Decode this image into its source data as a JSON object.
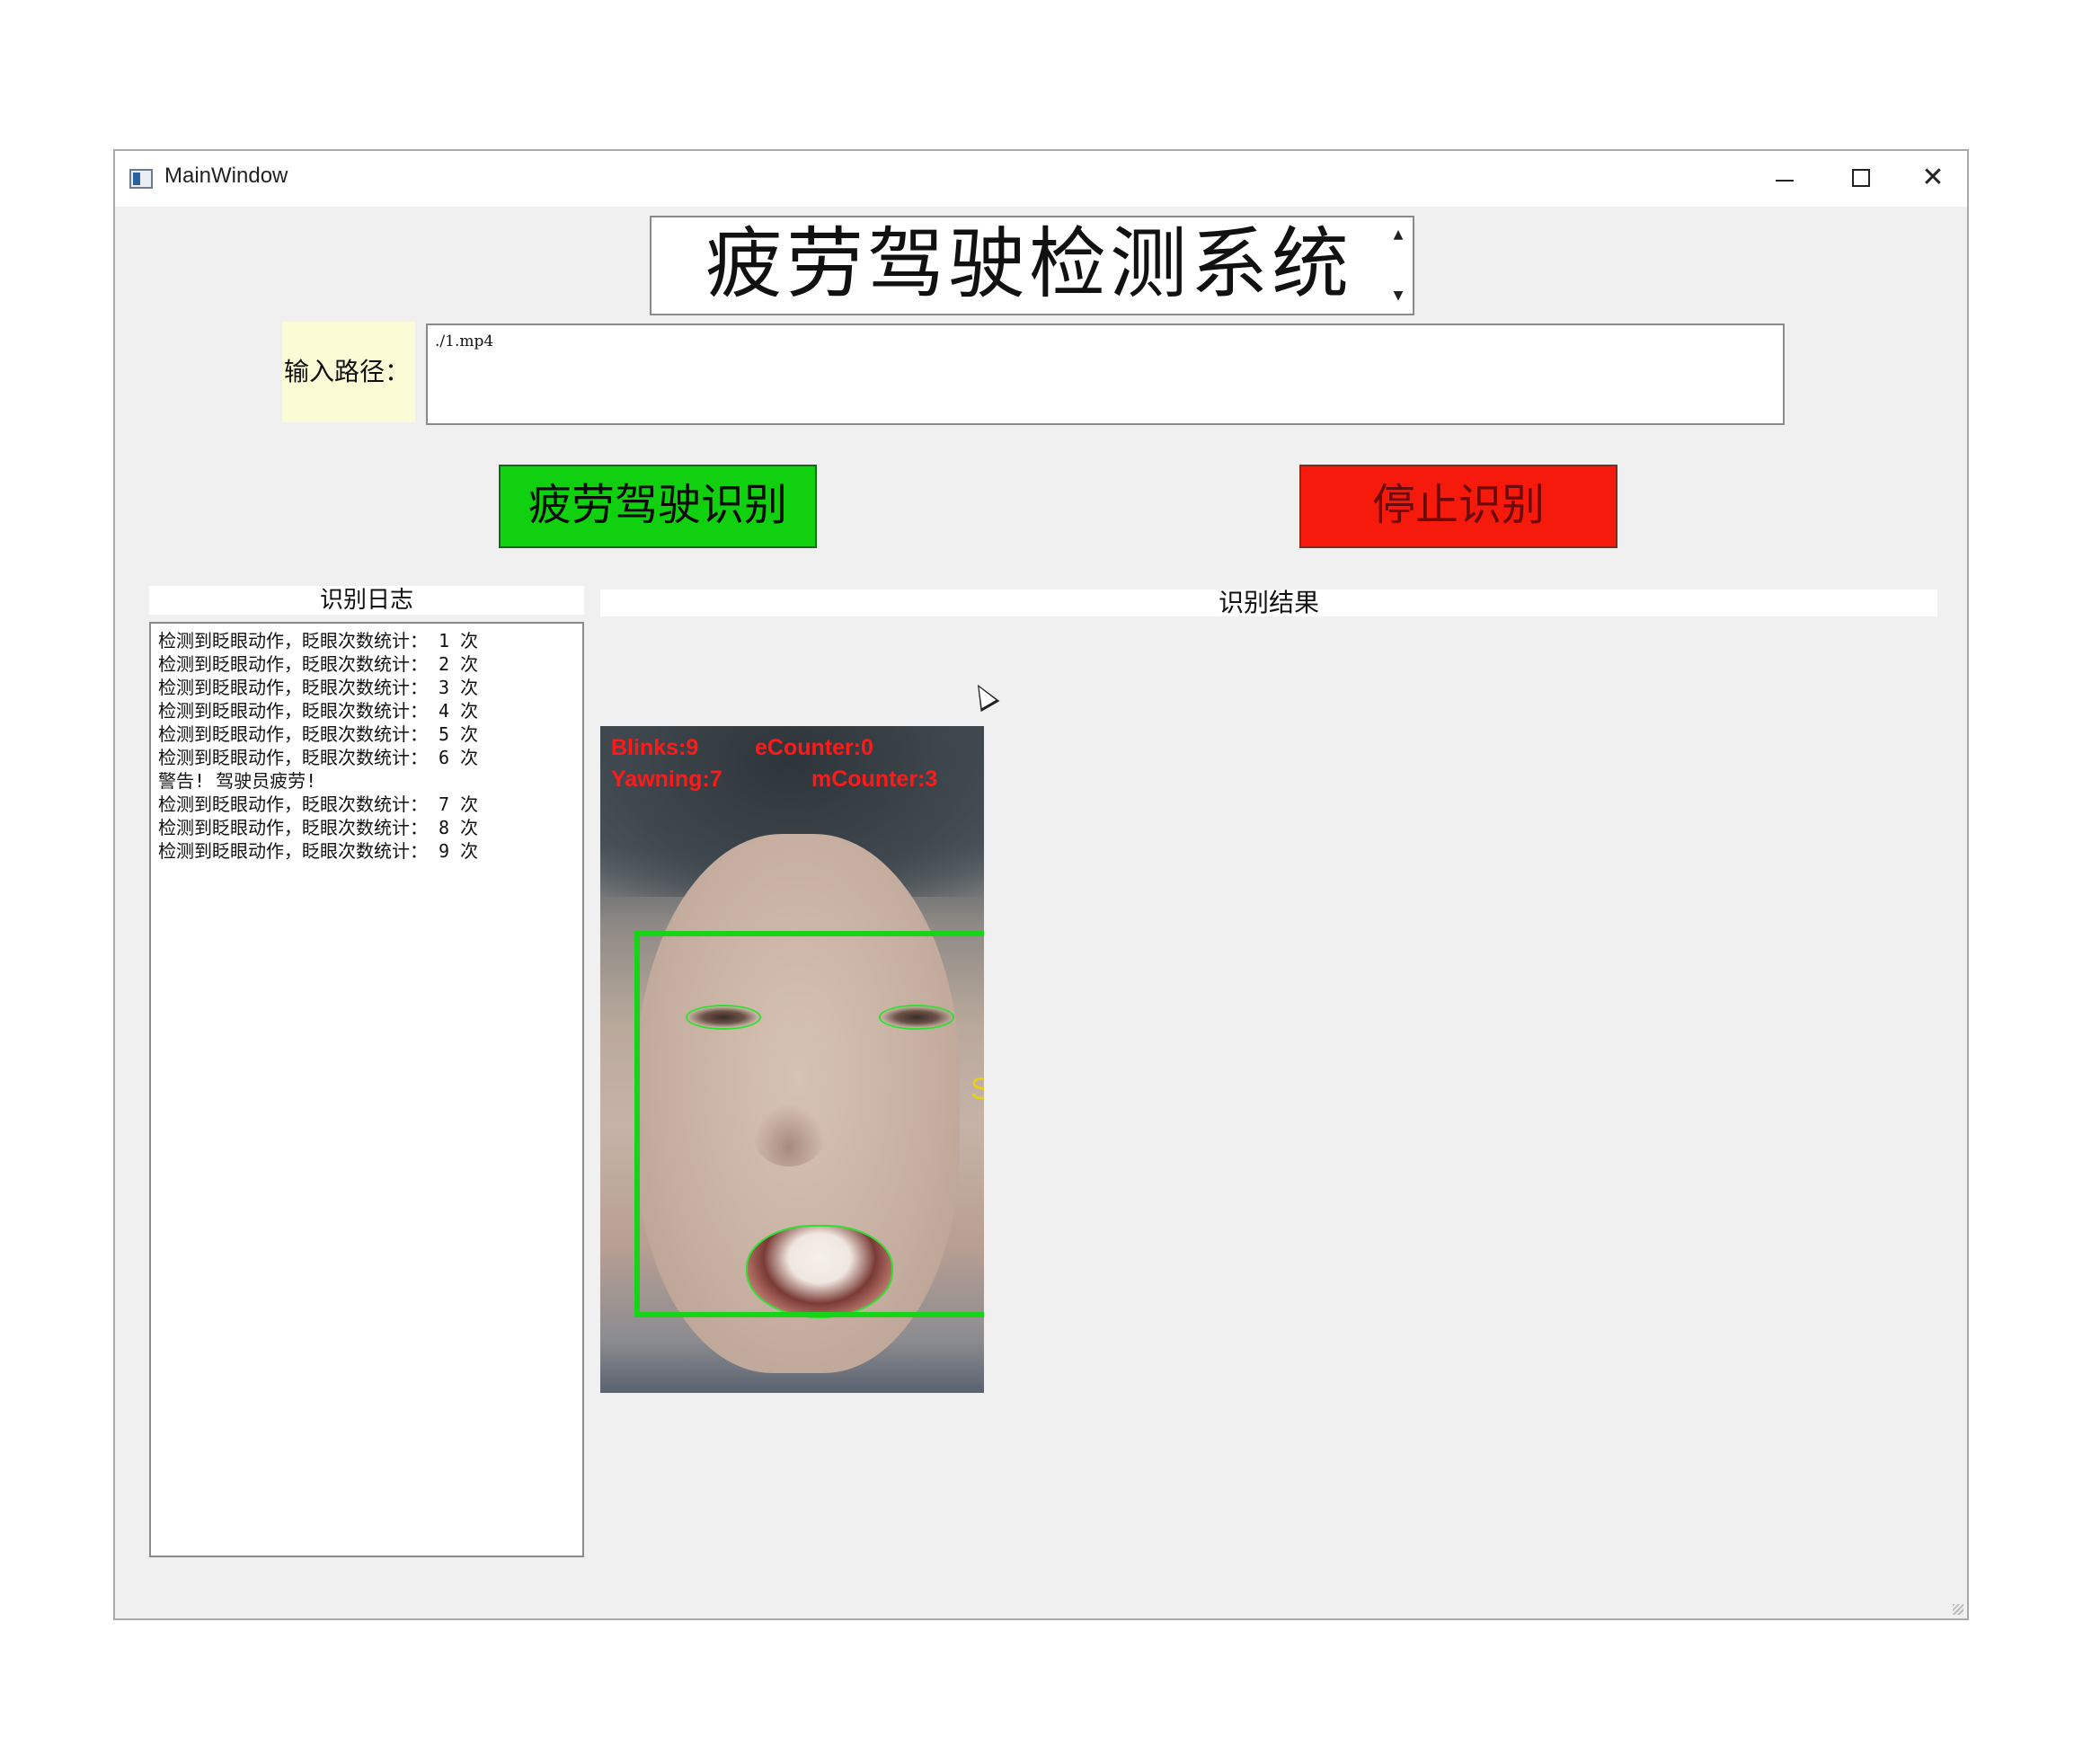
{
  "window": {
    "title": "MainWindow",
    "minimize_icon": "minimize-icon",
    "maximize_icon": "maximize-icon",
    "close_icon": "close-icon",
    "close_glyph": "✕"
  },
  "header": {
    "title": "疲劳驾驶检测系统",
    "spin_up": "▲",
    "spin_down": "▼"
  },
  "path": {
    "label": "输入路径：",
    "value": "./1.mp4"
  },
  "buttons": {
    "detect_label": "疲劳驾驶识别",
    "stop_label": "停止识别",
    "detect_color": "#10d010",
    "stop_color": "#f51a0c"
  },
  "log": {
    "header": "识别日志",
    "lines": [
      "检测到眨眼动作，眨眼次数统计： 1 次",
      "检测到眨眼动作，眨眼次数统计： 2 次",
      "检测到眨眼动作，眨眼次数统计： 3 次",
      "检测到眨眼动作，眨眼次数统计： 4 次",
      "检测到眨眼动作，眨眼次数统计： 5 次",
      "检测到眨眼动作，眨眼次数统计： 6 次",
      "警告! 驾驶员疲劳!",
      "检测到眨眼动作，眨眼次数统计： 7 次",
      "检测到眨眼动作，眨眼次数统计： 8 次",
      "检测到眨眼动作，眨眼次数统计： 9 次"
    ]
  },
  "result": {
    "header": "识别结果",
    "overlay": {
      "blinks": "Blinks:9",
      "ecounter": "eCounter:0",
      "yawning": "Yawning:7",
      "mcounter": "mCounter:3"
    },
    "side_mark": "S"
  }
}
